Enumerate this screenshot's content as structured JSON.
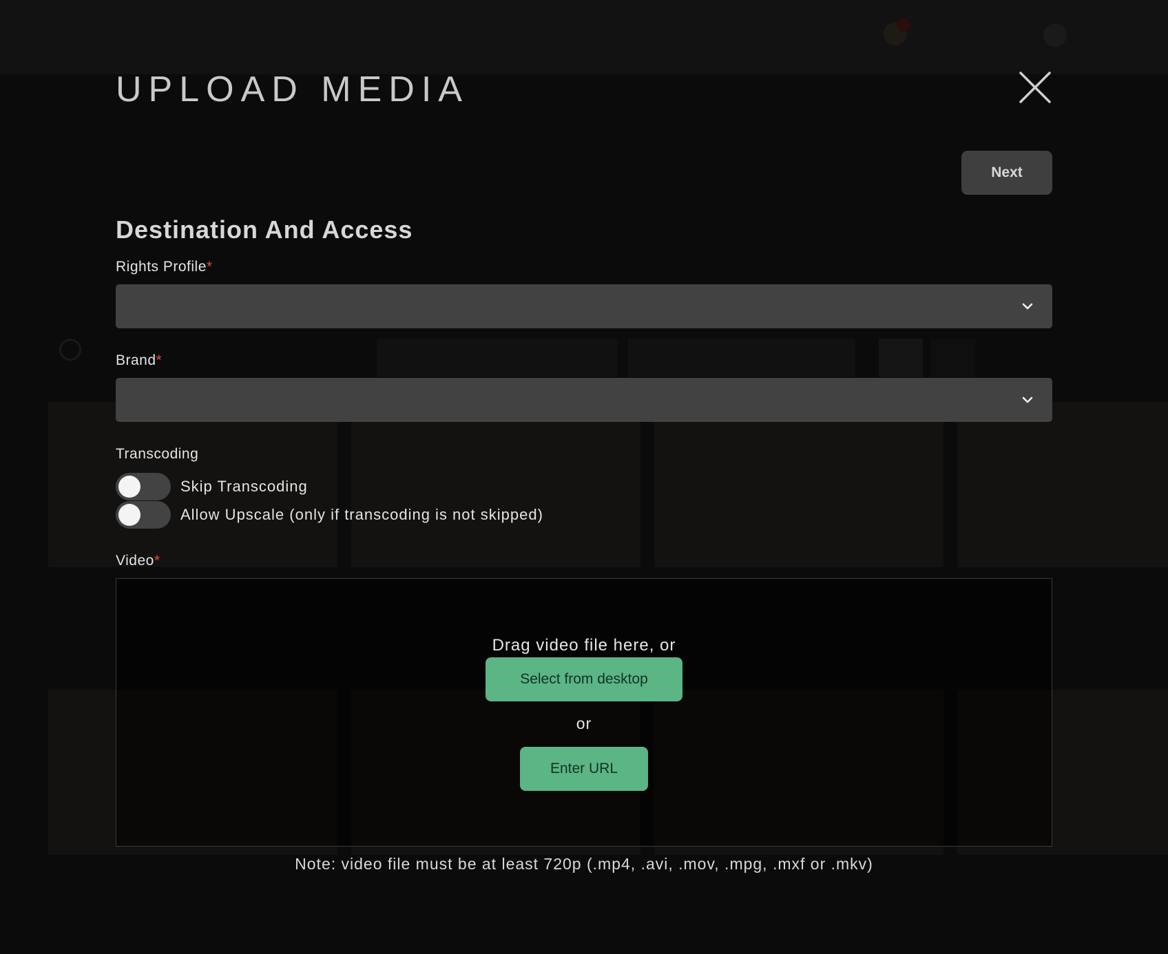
{
  "modal": {
    "title": "UPLOAD MEDIA",
    "next_label": "Next",
    "section_title": "Destination And Access",
    "rights_profile": {
      "label": "Rights Profile",
      "required_mark": "*",
      "value": ""
    },
    "brand": {
      "label": "Brand",
      "required_mark": "*",
      "value": ""
    },
    "transcoding": {
      "label": "Transcoding",
      "skip_label": "Skip Transcoding",
      "skip_on": false,
      "upscale_label": "Allow Upscale (only if transcoding is not skipped)",
      "upscale_on": false
    },
    "video": {
      "label": "Video",
      "required_mark": "*",
      "drag_text": "Drag video file here, or",
      "select_label": "Select from desktop",
      "or_text": "or",
      "url_label": "Enter URL",
      "note": "Note: video file must be at least 720p (.mp4, .avi, .mov, .mpg, .mxf or .mkv)"
    }
  },
  "colors": {
    "accent_green": "#5bb585",
    "required_red": "#e14b3f",
    "field_bg": "#424242"
  }
}
